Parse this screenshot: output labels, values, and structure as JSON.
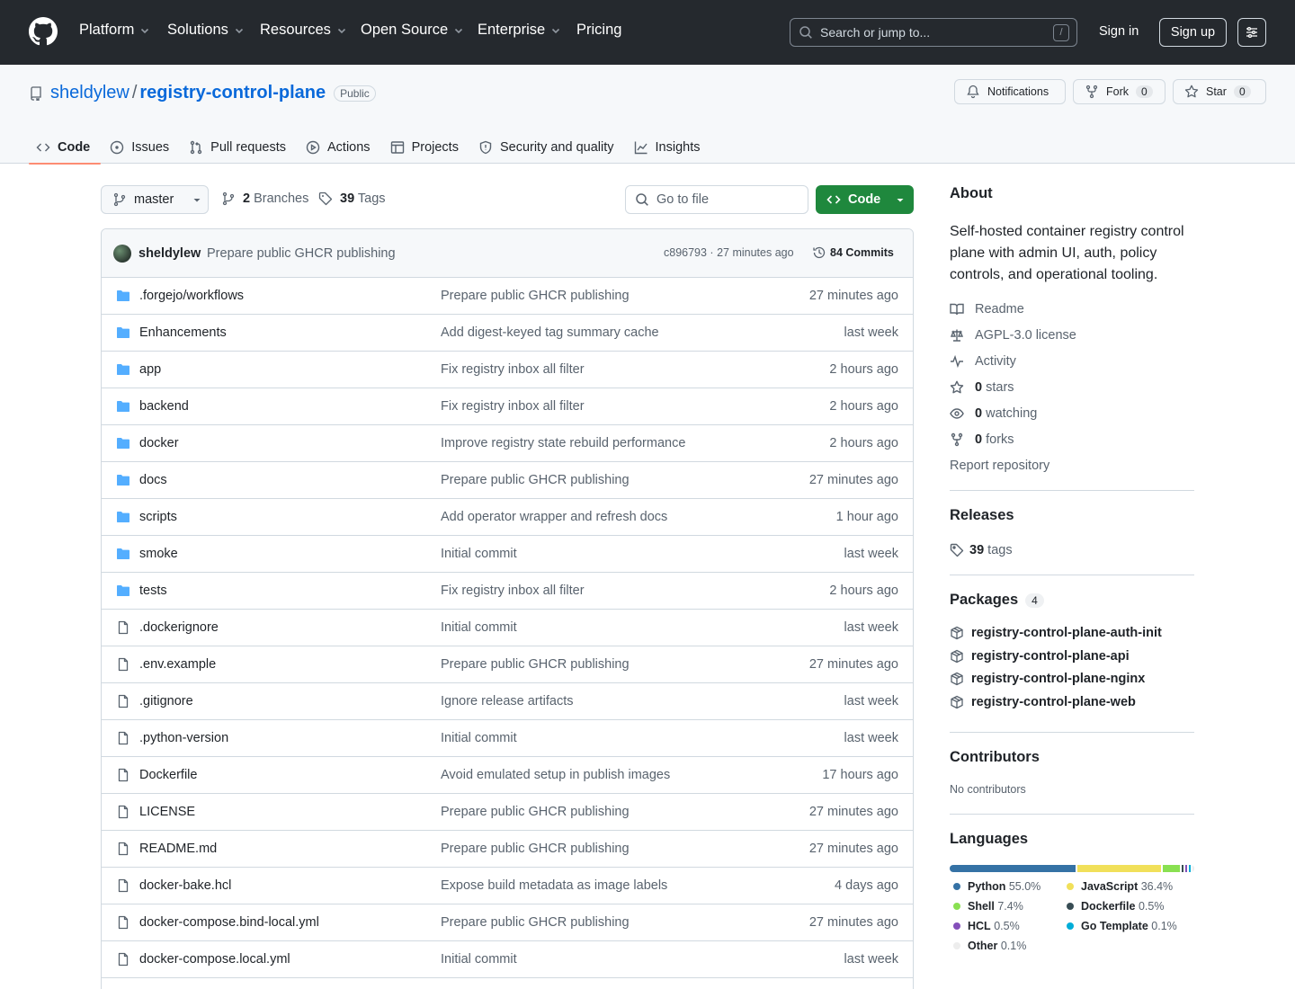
{
  "nav": {
    "items": [
      "Platform",
      "Solutions",
      "Resources",
      "Open Source",
      "Enterprise",
      "Pricing"
    ],
    "search_placeholder": "Search or jump to...",
    "search_shortcut": "/",
    "sign_in": "Sign in",
    "sign_up": "Sign up"
  },
  "repo": {
    "owner": "sheldylew",
    "separator": "/",
    "name": "registry-control-plane",
    "visibility": "Public",
    "notifications_label": "Notifications",
    "fork_label": "Fork",
    "fork_count": "0",
    "star_label": "Star",
    "star_count": "0"
  },
  "tabs": [
    "Code",
    "Issues",
    "Pull requests",
    "Actions",
    "Projects",
    "Security and quality",
    "Insights"
  ],
  "toolbar": {
    "branch": "master",
    "branches_count": "2",
    "branches_label": "Branches",
    "tags_count": "39",
    "tags_label": "Tags",
    "go_to_file": "Go to file",
    "code_button": "Code"
  },
  "latest_commit": {
    "author": "sheldylew",
    "message": "Prepare public GHCR publishing",
    "hash_time": "c896793 · 27 minutes ago",
    "commits": "84 Commits"
  },
  "files": [
    {
      "type": "dir",
      "name": ".forgejo/workflows",
      "message": "Prepare public GHCR publishing",
      "age": "27 minutes ago"
    },
    {
      "type": "dir",
      "name": "Enhancements",
      "message": "Add digest-keyed tag summary cache",
      "age": "last week"
    },
    {
      "type": "dir",
      "name": "app",
      "message": "Fix registry inbox all filter",
      "age": "2 hours ago"
    },
    {
      "type": "dir",
      "name": "backend",
      "message": "Fix registry inbox all filter",
      "age": "2 hours ago"
    },
    {
      "type": "dir",
      "name": "docker",
      "message": "Improve registry state rebuild performance",
      "age": "2 hours ago"
    },
    {
      "type": "dir",
      "name": "docs",
      "message": "Prepare public GHCR publishing",
      "age": "27 minutes ago"
    },
    {
      "type": "dir",
      "name": "scripts",
      "message": "Add operator wrapper and refresh docs",
      "age": "1 hour ago"
    },
    {
      "type": "dir",
      "name": "smoke",
      "message": "Initial commit",
      "age": "last week"
    },
    {
      "type": "dir",
      "name": "tests",
      "message": "Fix registry inbox all filter",
      "age": "2 hours ago"
    },
    {
      "type": "file",
      "name": ".dockerignore",
      "message": "Initial commit",
      "age": "last week"
    },
    {
      "type": "file",
      "name": ".env.example",
      "message": "Prepare public GHCR publishing",
      "age": "27 minutes ago"
    },
    {
      "type": "file",
      "name": ".gitignore",
      "message": "Ignore release artifacts",
      "age": "last week"
    },
    {
      "type": "file",
      "name": ".python-version",
      "message": "Initial commit",
      "age": "last week"
    },
    {
      "type": "file",
      "name": "Dockerfile",
      "message": "Avoid emulated setup in publish images",
      "age": "17 hours ago"
    },
    {
      "type": "file",
      "name": "LICENSE",
      "message": "Prepare public GHCR publishing",
      "age": "27 minutes ago"
    },
    {
      "type": "file",
      "name": "README.md",
      "message": "Prepare public GHCR publishing",
      "age": "27 minutes ago"
    },
    {
      "type": "file",
      "name": "docker-bake.hcl",
      "message": "Expose build metadata as image labels",
      "age": "4 days ago"
    },
    {
      "type": "file",
      "name": "docker-compose.bind-local.yml",
      "message": "Prepare public GHCR publishing",
      "age": "27 minutes ago"
    },
    {
      "type": "file",
      "name": "docker-compose.local.yml",
      "message": "Initial commit",
      "age": "last week"
    }
  ],
  "about": {
    "title": "About",
    "description": "Self-hosted container registry control plane with admin UI, auth, policy controls, and operational tooling.",
    "readme": "Readme",
    "license": "AGPL-3.0 license",
    "activity": "Activity",
    "stars_count": "0",
    "stars_label": "stars",
    "watching_count": "0",
    "watching_label": "watching",
    "forks_count": "0",
    "forks_label": "forks",
    "report": "Report repository"
  },
  "releases": {
    "title": "Releases",
    "tags_count": "39",
    "tags_label": "tags"
  },
  "packages": {
    "title": "Packages",
    "count": "4",
    "items": [
      "registry-control-plane-auth-init",
      "registry-control-plane-api",
      "registry-control-plane-nginx",
      "registry-control-plane-web"
    ]
  },
  "contributors": {
    "title": "Contributors",
    "empty": "No contributors"
  },
  "languages": {
    "title": "Languages",
    "items": [
      {
        "name": "Python",
        "percent": "55.0%",
        "value": 55.0,
        "color": "#3572A5"
      },
      {
        "name": "JavaScript",
        "percent": "36.4%",
        "value": 36.4,
        "color": "#f1e05a"
      },
      {
        "name": "Shell",
        "percent": "7.4%",
        "value": 7.4,
        "color": "#89e051"
      },
      {
        "name": "Dockerfile",
        "percent": "0.5%",
        "value": 0.5,
        "color": "#384d54"
      },
      {
        "name": "HCL",
        "percent": "0.5%",
        "value": 0.5,
        "color": "#844FBA"
      },
      {
        "name": "Go Template",
        "percent": "0.1%",
        "value": 0.1,
        "color": "#00ADD8"
      },
      {
        "name": "Other",
        "percent": "0.1%",
        "value": 0.1,
        "color": "#ededed"
      }
    ]
  }
}
